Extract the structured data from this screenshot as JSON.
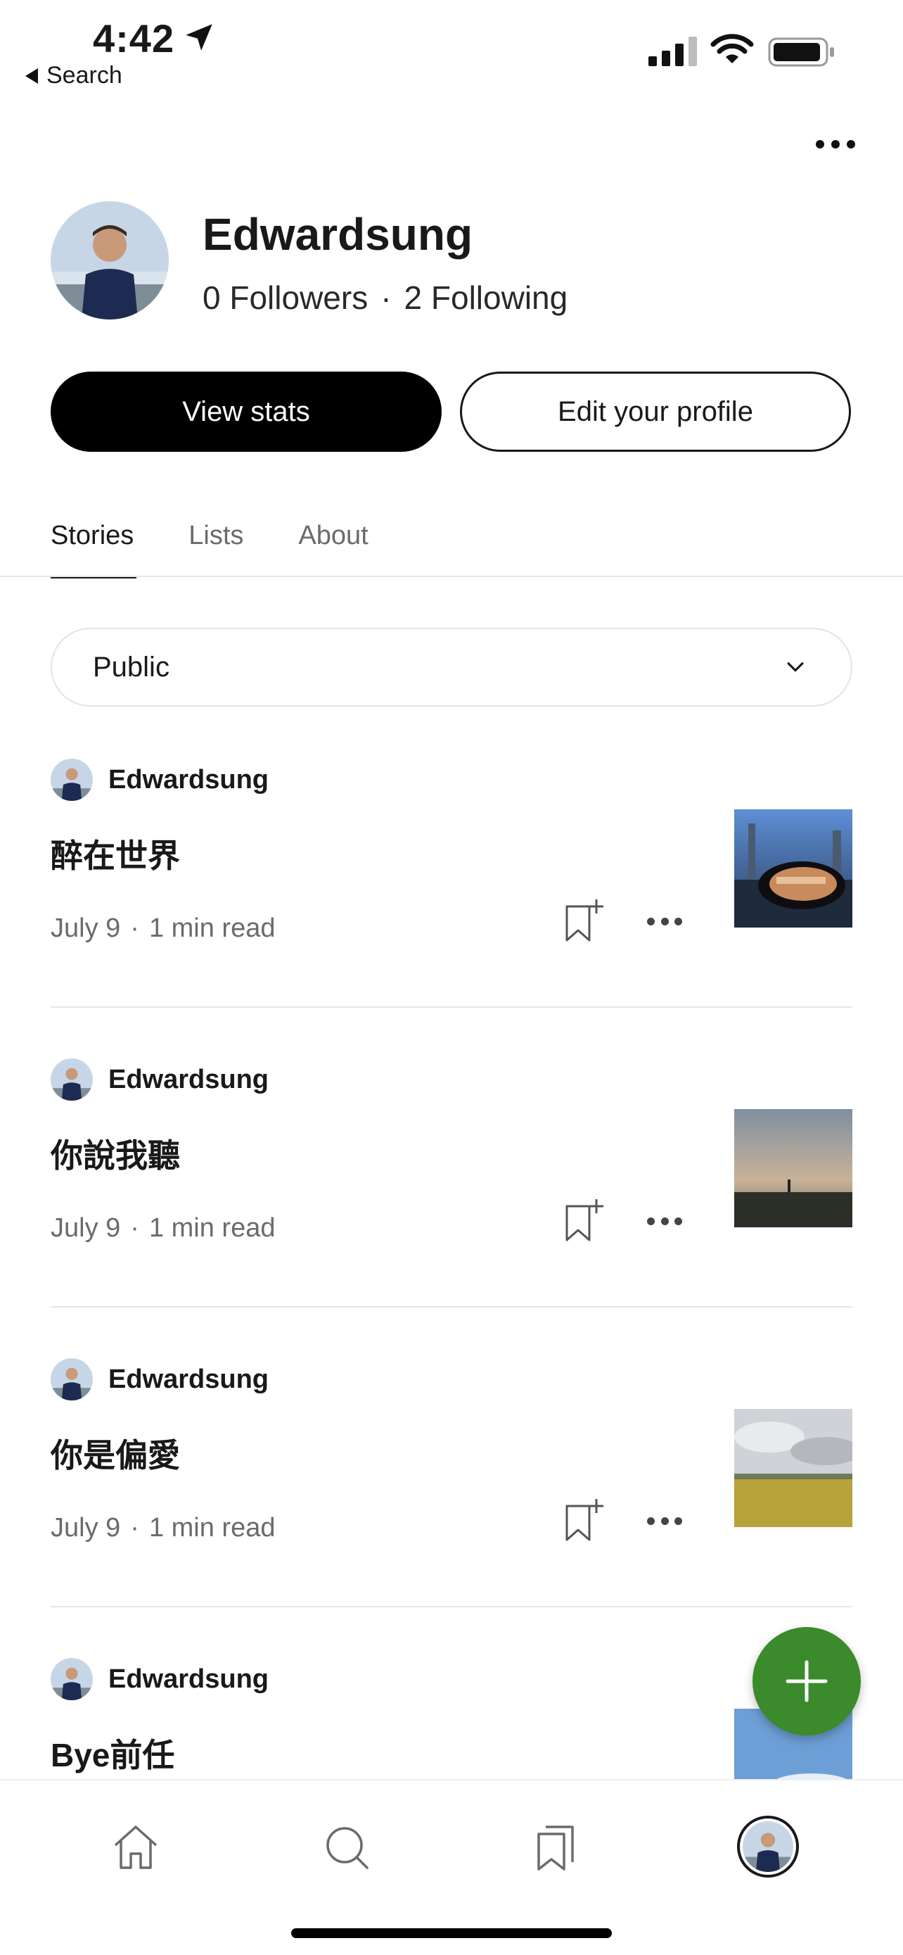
{
  "status_bar": {
    "time": "4:42",
    "back_label": "Search"
  },
  "profile": {
    "name": "Edwardsung",
    "followers": "0 Followers",
    "separator": "·",
    "following": "2 Following",
    "view_stats_label": "View stats",
    "edit_profile_label": "Edit your profile"
  },
  "tabs": [
    {
      "label": "Stories",
      "active": true
    },
    {
      "label": "Lists",
      "active": false
    },
    {
      "label": "About",
      "active": false
    }
  ],
  "filter": {
    "selected": "Public"
  },
  "stories": [
    {
      "author": "Edwardsung",
      "title": "醉在世界",
      "date": "July 9",
      "sep": "·",
      "read_time": "1 min read"
    },
    {
      "author": "Edwardsung",
      "title": "你說我聽",
      "date": "July 9",
      "sep": "·",
      "read_time": "1 min read"
    },
    {
      "author": "Edwardsung",
      "title": "你是偏愛",
      "date": "July 9",
      "sep": "·",
      "read_time": "1 min read"
    },
    {
      "author": "Edwardsung",
      "title": "Bye前任"
    }
  ],
  "colors": {
    "accent_green": "#3b8a2c",
    "primary_black": "#000000",
    "muted_text": "#6b6b6b"
  },
  "icons": {
    "fab": "plus-icon",
    "nav": [
      "home-icon",
      "search-icon",
      "bookmarks-icon",
      "profile-avatar"
    ]
  }
}
